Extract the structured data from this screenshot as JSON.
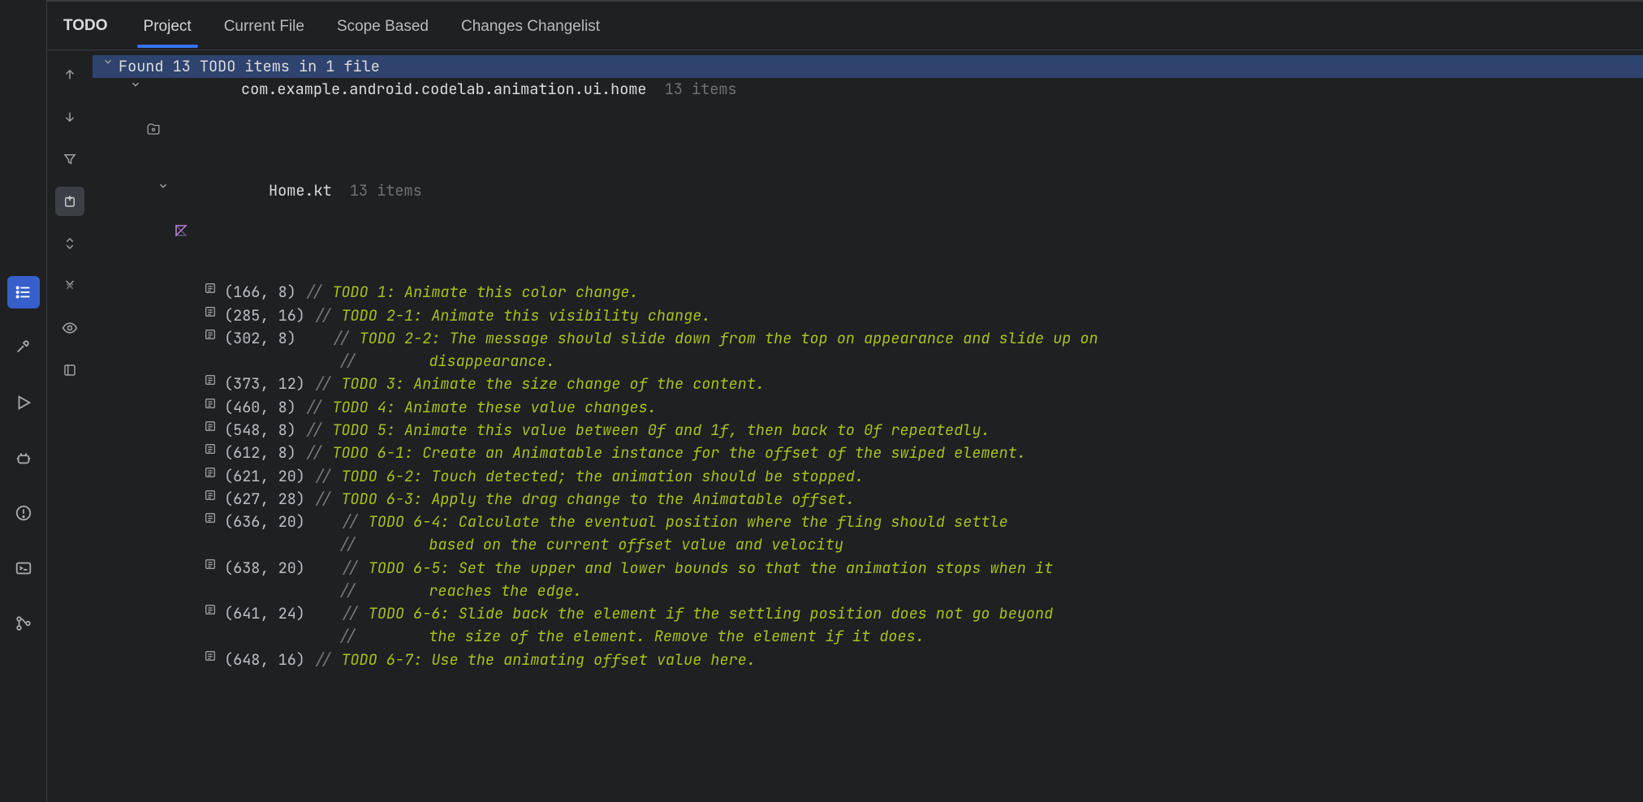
{
  "panel_title": "TODO",
  "tabs": {
    "project": "Project",
    "current_file": "Current File",
    "scope_based": "Scope Based",
    "changes": "Changes Changelist"
  },
  "summary": "Found 13 TODO items in 1 file",
  "package": {
    "name": "com.example.android.codelab.animation.ui.home",
    "count": "13 items"
  },
  "file": {
    "name": "Home.kt",
    "count": "13 items"
  },
  "items": [
    {
      "loc": "(166, 8)",
      "slash": "// ",
      "text": "TODO 1: Animate this color change."
    },
    {
      "loc": "(285, 16)",
      "slash": "// ",
      "text": "TODO 2-1: Animate this visibility change."
    },
    {
      "loc": "(302, 8)",
      "slash": "   // ",
      "text": "TODO 2-2: The message should slide down from the top on appearance and slide up on",
      "cont_slash": "   //        ",
      "cont_text": "disappearance."
    },
    {
      "loc": "(373, 12)",
      "slash": "// ",
      "text": "TODO 3: Animate the size change of the content."
    },
    {
      "loc": "(460, 8)",
      "slash": "// ",
      "text": "TODO 4: Animate these value changes."
    },
    {
      "loc": "(548, 8)",
      "slash": "// ",
      "text": "TODO 5: Animate this value between 0f and 1f, then back to 0f repeatedly."
    },
    {
      "loc": "(612, 8)",
      "slash": "// ",
      "text": "TODO 6-1: Create an Animatable instance for the offset of the swiped element."
    },
    {
      "loc": "(621, 20)",
      "slash": "// ",
      "text": "TODO 6-2: Touch detected; the animation should be stopped."
    },
    {
      "loc": "(627, 28)",
      "slash": "// ",
      "text": "TODO 6-3: Apply the drag change to the Animatable offset."
    },
    {
      "loc": "(636, 20)",
      "slash": "   // ",
      "text": "TODO 6-4: Calculate the eventual position where the fling should settle",
      "cont_slash": "   //        ",
      "cont_text": "based on the current offset value and velocity"
    },
    {
      "loc": "(638, 20)",
      "slash": "   // ",
      "text": "TODO 6-5: Set the upper and lower bounds so that the animation stops when it",
      "cont_slash": "   //        ",
      "cont_text": "reaches the edge."
    },
    {
      "loc": "(641, 24)",
      "slash": "   // ",
      "text": "TODO 6-6: Slide back the element if the settling position does not go beyond",
      "cont_slash": "   //        ",
      "cont_text": "the size of the element. Remove the element if it does."
    },
    {
      "loc": "(648, 16)",
      "slash": "// ",
      "text": "TODO 6-7: Use the animating offset value here."
    }
  ]
}
